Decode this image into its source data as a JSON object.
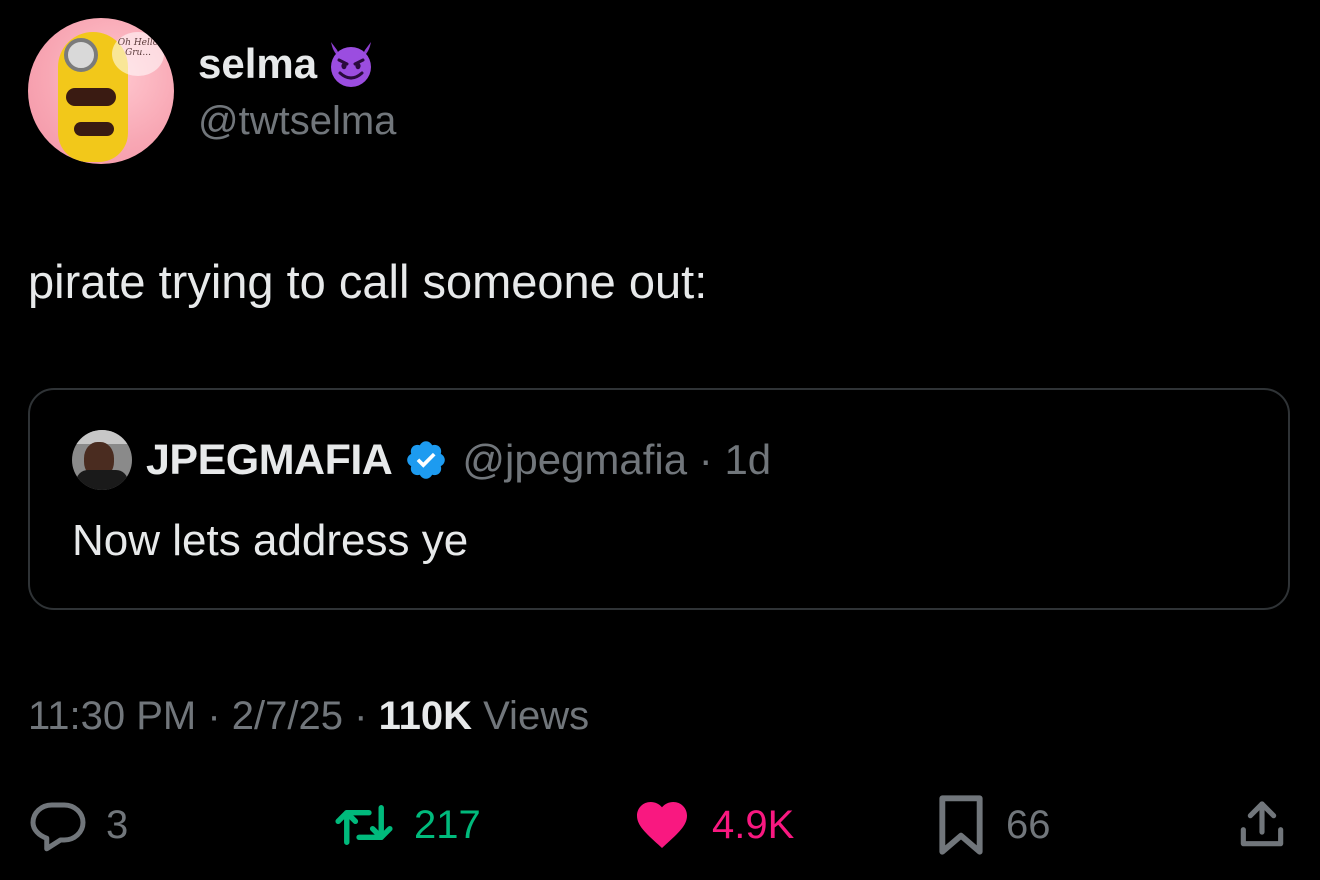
{
  "author": {
    "display_name": "selma",
    "emoji": "smiling-devil-emoji",
    "handle": "@twtselma",
    "avatar_bubble_text": "Oh Hello Gru..."
  },
  "tweet": {
    "text": "pirate trying to call someone out:"
  },
  "quote": {
    "display_name": "JPEGMAFIA",
    "verified": true,
    "handle_time": "@jpegmafia · 1d",
    "text": "Now lets address ye"
  },
  "meta": {
    "time": "11:30 PM",
    "sep1": " · ",
    "date": "2/7/25",
    "sep2": " · ",
    "views_count": "110K",
    "views_label": " Views"
  },
  "actions": {
    "replies": "3",
    "retweets": "217",
    "likes": "4.9K",
    "bookmarks": "66"
  },
  "colors": {
    "background": "#000000",
    "primary_text": "#e7e9ea",
    "secondary_text": "#71767b",
    "retweet_green": "#00ba7c",
    "like_pink": "#f91880",
    "verified_blue": "#1d9bf0",
    "quote_border": "#2f3336"
  }
}
